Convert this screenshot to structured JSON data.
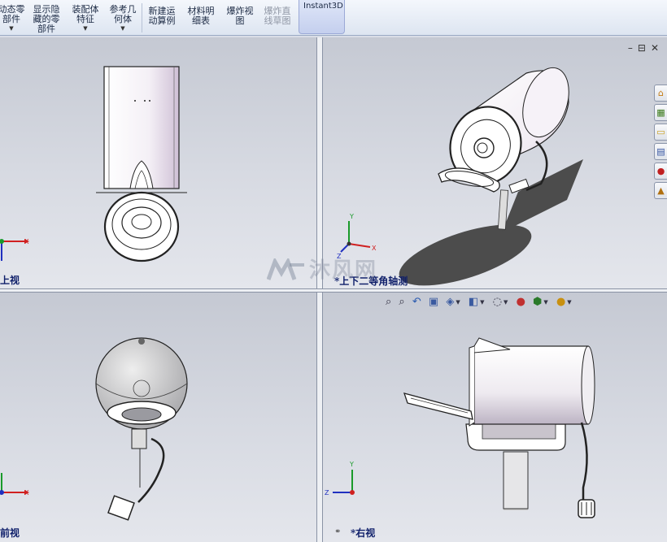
{
  "ribbon": {
    "items": [
      {
        "label": "动态零\n部件",
        "dropdown": true,
        "dimmed": false
      },
      {
        "label": "显示隐\n藏的零\n部件",
        "dropdown": false,
        "dimmed": false
      },
      {
        "label": "装配体\n特征",
        "dropdown": true,
        "dimmed": false
      },
      {
        "label": "参考几\n何体",
        "dropdown": true,
        "dimmed": false
      },
      {
        "label": "新建运\n动算例",
        "dropdown": false,
        "dimmed": false
      },
      {
        "label": "材料明\n细表",
        "dropdown": false,
        "dimmed": false
      },
      {
        "label": "爆炸视\n图",
        "dropdown": false,
        "dimmed": false
      },
      {
        "label": "爆炸直\n线草图",
        "dropdown": false,
        "dimmed": true
      }
    ],
    "instant3d_label": "Instant3D"
  },
  "viewports": {
    "top_label": "上视",
    "iso_label": "*上下二等角轴测",
    "front_label": "前视",
    "right_label": "*右视"
  },
  "watermark": {
    "text": "沐风网"
  },
  "window_controls": {
    "minimize": "–",
    "restore": "⊟",
    "close": "✕"
  },
  "heads_up_toolbar": {
    "icons": [
      "zoom-to-fit-icon",
      "zoom-area-icon",
      "previous-view-icon",
      "section-view-icon",
      "view-orientation-icon",
      "display-style-icon",
      "hide-show-items-icon",
      "edit-appearance-icon",
      "apply-scene-icon",
      "view-settings-icon"
    ]
  },
  "task_pane": {
    "icons": [
      "home-icon",
      "design-library-icon",
      "file-explorer-icon",
      "view-palette-icon",
      "appearances-icon",
      "custom-properties-icon"
    ]
  },
  "axes": {
    "x": "X",
    "y": "Y",
    "z": "Z"
  },
  "colors": {
    "axis_x": "#d02020",
    "axis_y": "#1a9a2a",
    "axis_z": "#2030c0",
    "viewport_label": "#0f1f6a"
  }
}
